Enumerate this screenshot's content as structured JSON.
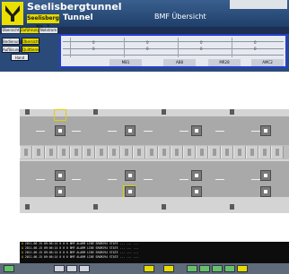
{
  "header": {
    "title": "Seelisbergtunnel",
    "section_badge": "Seelisberg Nr. 1",
    "tunnel_label": "Tunnel",
    "view_title": "BMF Übersicht"
  },
  "topnav": {
    "tabs": [
      {
        "label": "Übersicht",
        "active": false
      },
      {
        "label": "Zuführungen",
        "active": true
      },
      {
        "label": "Notstrom",
        "active": false
      }
    ]
  },
  "controls": {
    "buttons": [
      {
        "label": "Bedienung",
        "active": false
      },
      {
        "label": "Übersicht",
        "active": true
      },
      {
        "label": "Auflösung",
        "active": false
      },
      {
        "label": "Quittieren",
        "active": true
      },
      {
        "label": "Hand",
        "active": false
      }
    ]
  },
  "measurement": {
    "columns": [
      {
        "label": "MB1",
        "tick_a": "0",
        "tick_b": "0"
      },
      {
        "label": "AB8",
        "tick_a": "0",
        "tick_b": "0"
      },
      {
        "label": "MR28",
        "tick_a": "0",
        "tick_b": "0"
      },
      {
        "label": "AMC2",
        "tick_a": "0",
        "tick_b": "0"
      }
    ]
  },
  "tunnel": {
    "camera_count": 10,
    "selected_cameras": [
      0,
      6
    ]
  },
  "log": {
    "rows": [
      {
        "time": "2011.06.15 09:06:14",
        "text": "0  0  0  BMF  ALARM  LINE    SROM294      STATE    ...  ...  ...",
        "sev": "A"
      },
      {
        "time": "2011.06.15 09:06:14",
        "text": "0  0  0  BMF  ALARM  LINE    SROM294      STATE    ...  ...  ...",
        "sev": "A"
      },
      {
        "time": "2011.06.15 09:06:14",
        "text": "0  0  0  BMF  ALARM  LINE    SROM294      STATE    ...  ...  ...",
        "sev": "A"
      },
      {
        "time": "2011.06.15 09:06:14",
        "text": "0  0  0  BMF  ALARM  LINE    SROM294      STATE    ...  ...  ...",
        "sev": "A"
      }
    ]
  },
  "colors": {
    "header_blue": "#1f3f6a",
    "accent_yellow": "#e6dc00",
    "selection_blue": "#263fcf",
    "road_gray": "#a9a9a9",
    "log_background": "#0d0d0d"
  },
  "icons": {
    "logo": "tunnel-logo-icon",
    "camera": "camera-icon",
    "bottom_buttons": [
      "nav-icon",
      "nav-icon",
      "nav-icon",
      "nav-icon",
      "nav-icon",
      "nav-icon",
      "nav-icon",
      "nav-icon"
    ]
  }
}
